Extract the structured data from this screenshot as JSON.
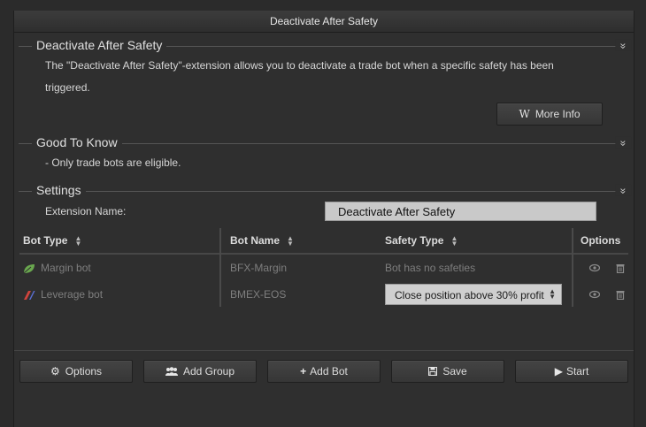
{
  "window": {
    "title": "Deactivate After Safety"
  },
  "sections": {
    "about": {
      "title": "Deactivate After Safety",
      "line1": "The \"Deactivate After Safety\"-extension allows you to deactivate a trade bot when a specific safety has been",
      "line2": "triggered.",
      "more_info": {
        "icon": "W",
        "label": "More Info"
      }
    },
    "good_to_know": {
      "title": "Good To Know",
      "text": "- Only trade bots are eligible."
    },
    "settings": {
      "title": "Settings",
      "ext_name_label": "Extension Name:",
      "ext_name_value": "Deactivate After Safety"
    }
  },
  "collapse_glyph": "»",
  "table": {
    "columns": [
      "Bot Type",
      "Bot Name",
      "Safety Type",
      "Options"
    ],
    "rows": [
      {
        "type": "Margin bot",
        "name": "BFX-Margin",
        "safety": "Bot has no safeties",
        "icon": "leaf-icon",
        "icon_color": "#6aa84f"
      },
      {
        "type": "Leverage bot",
        "name": "BMEX-EOS",
        "safety": "Close position above 30% profit",
        "icon": "leverage-icon",
        "icon_color": "#d0433c"
      }
    ]
  },
  "toolbar": {
    "options": "Options",
    "add_group": "Add Group",
    "add_bot": "Add Bot",
    "save": "Save",
    "start": "Start"
  },
  "colors": {
    "accent_red": "#d0433c",
    "accent_blue": "#5b6fd6",
    "leaf_green": "#6aa84f"
  }
}
